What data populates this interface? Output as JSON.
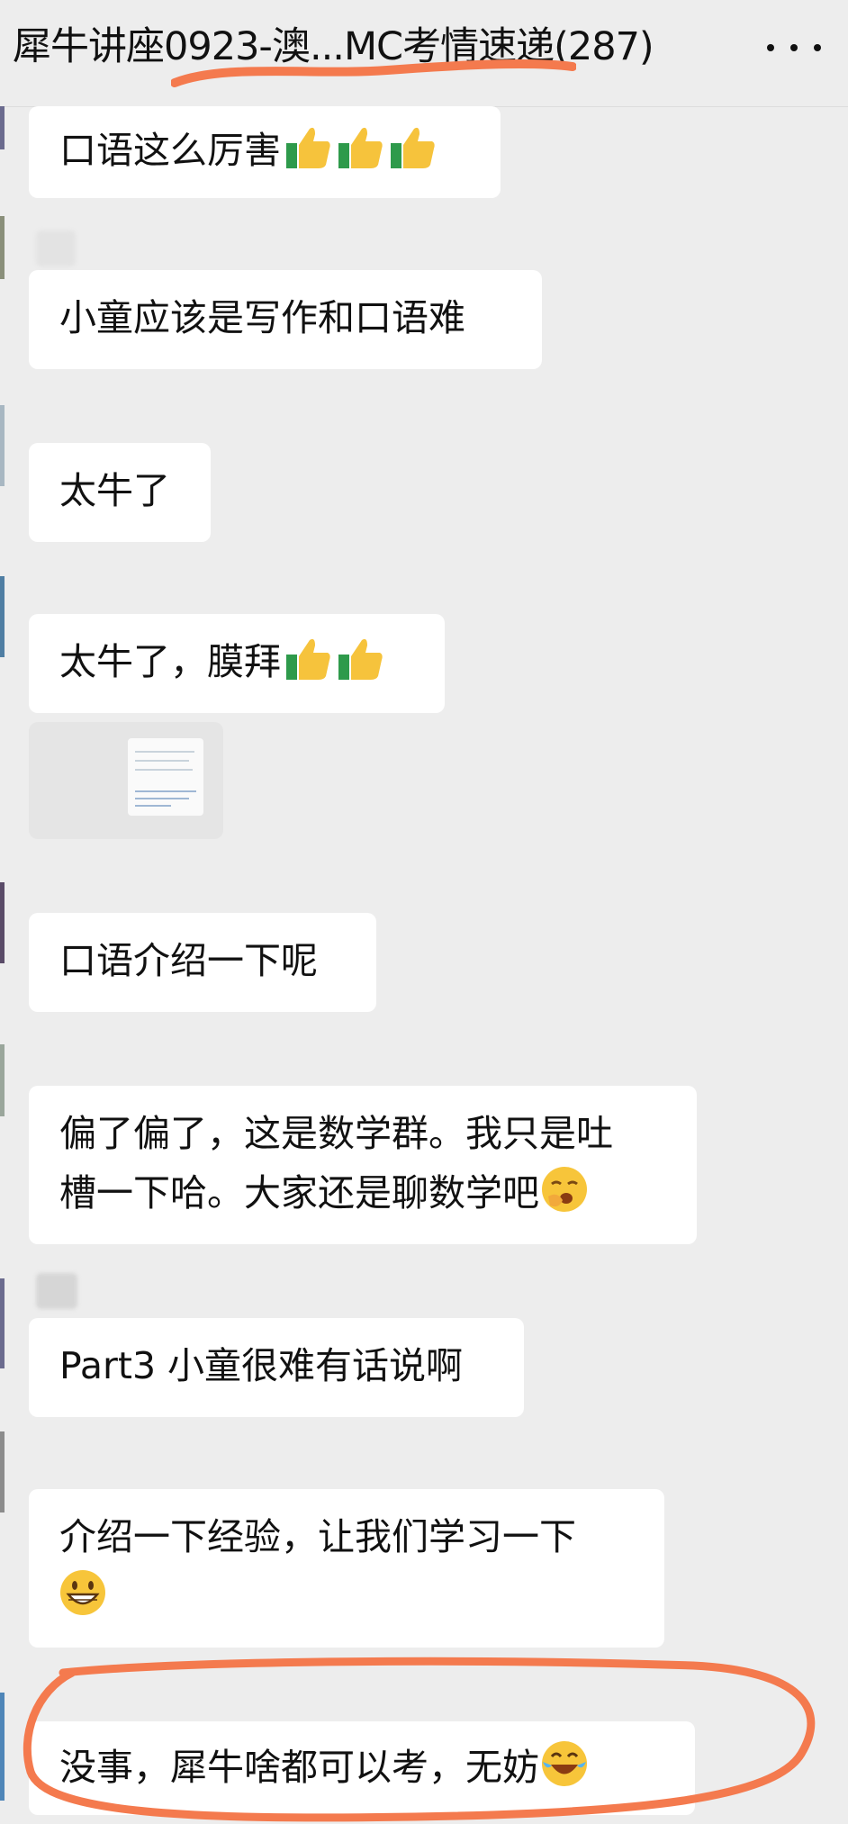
{
  "header": {
    "title": "犀牛讲座0923-澳...MC考情速递(287)",
    "more_icon": "more-dots-icon"
  },
  "messages": [
    {
      "text": "口语这么厉害",
      "emoji": [
        "thumbs-up-icon",
        "thumbs-up-icon",
        "thumbs-up-icon"
      ]
    },
    {
      "text": "小童应该是写作和口语难"
    },
    {
      "text": "太牛了"
    },
    {
      "text": "太牛了，膜拜",
      "emoji": [
        "thumbs-up-icon",
        "thumbs-up-icon"
      ]
    },
    {
      "text": "口语介绍一下呢"
    },
    {
      "line1": "偏了偏了，这是数学群。我只是吐",
      "line2": "槽一下哈。大家还是聊数学吧",
      "emoji": [
        "yawning-face-icon"
      ]
    },
    {
      "text": "Part3 小童很难有话说啊"
    },
    {
      "line1": "介绍一下经验，让我们学习一下",
      "emoji": [
        "grinning-face-icon"
      ]
    },
    {
      "text": "没事，犀牛啥都可以考，无妨",
      "emoji": [
        "laughing-tears-icon"
      ]
    }
  ],
  "colors": {
    "background": "#ededed",
    "bubble": "#ffffff",
    "annotation": "#f47a4e"
  }
}
